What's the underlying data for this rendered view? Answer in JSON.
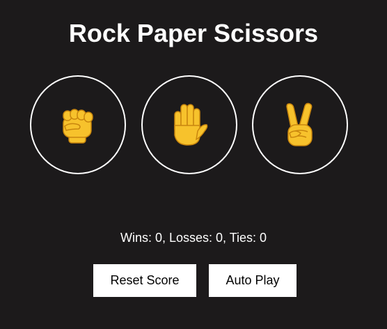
{
  "title": "Rock Paper Scissors",
  "choices": [
    {
      "name": "rock",
      "icon": "fist-icon"
    },
    {
      "name": "paper",
      "icon": "raised-hand-icon"
    },
    {
      "name": "scissors",
      "icon": "victory-hand-icon"
    }
  ],
  "score_text": "Wins: 0, Losses: 0, Ties: 0",
  "buttons": {
    "reset_label": "Reset Score",
    "auto_play_label": "Auto Play"
  },
  "colors": {
    "background": "#1c1a1b",
    "emoji_skin": "#f7c22c",
    "emoji_outline": "#c9860e"
  }
}
